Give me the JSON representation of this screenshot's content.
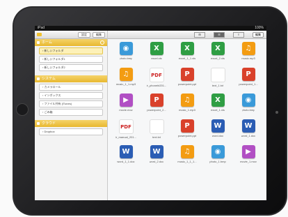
{
  "status": {
    "carrier": "iPad",
    "battery": "100%"
  },
  "sidebar": {
    "top_buttons": [
      "設定",
      "編集"
    ],
    "home": {
      "title": "ホーム",
      "items": [
        "新しいフォルダ",
        "新しいフォルダ1",
        "新しいフォルダ2"
      ]
    },
    "system": {
      "title": "システム",
      "items": [
        "カメラロール",
        "インボックス",
        "ファイル共有 (iTunes)",
        "ごみ箱"
      ]
    },
    "cloud": {
      "title": "クラウド",
      "items": [
        "Dropbox"
      ]
    }
  },
  "toolbar": {
    "edit": "編集",
    "views": [
      "⊞",
      "☰",
      "≡"
    ]
  },
  "colors": {
    "excel": "#2f9e44",
    "ppt": "#d9412b",
    "word": "#2b5db4",
    "music": "#f39c12",
    "photo": "#3a9ad9",
    "movie": "#b14fc4"
  },
  "files": [
    {
      "name": "photo.bmp",
      "kind": "photo",
      "glyph": "◉"
    },
    {
      "name": "excel.xls",
      "kind": "excel",
      "glyph": "X"
    },
    {
      "name": "excel_1_1.xls",
      "kind": "excel",
      "glyph": "X"
    },
    {
      "name": "excel_2.xls",
      "kind": "excel",
      "glyph": "X"
    },
    {
      "name": "music.mp3",
      "kind": "music",
      "glyph": "♫"
    },
    {
      "name": "music_1_1.mp3",
      "kind": "music",
      "glyph": "♫"
    },
    {
      "name": "ir_phonebi201...",
      "kind": "pdf",
      "glyph": "PDF"
    },
    {
      "name": "powerpoint.ppt",
      "kind": "ppt",
      "glyph": "P"
    },
    {
      "name": "text_1.txt",
      "kind": "txt",
      "glyph": ""
    },
    {
      "name": "powerpoint_1...",
      "kind": "ppt",
      "glyph": "P"
    },
    {
      "name": "movie.mov",
      "kind": "movie",
      "glyph": "▶"
    },
    {
      "name": "powerpoint_2...",
      "kind": "ppt",
      "glyph": "P"
    },
    {
      "name": "music_1.mp3",
      "kind": "music",
      "glyph": "♫"
    },
    {
      "name": "excel_1.xls",
      "kind": "excel",
      "glyph": "X"
    },
    {
      "name": "photo.bmp",
      "kind": "photo",
      "glyph": "◉"
    },
    {
      "name": "ir_manual_201...",
      "kind": "pdf",
      "glyph": "PDF"
    },
    {
      "name": "text.txt",
      "kind": "txt",
      "glyph": ""
    },
    {
      "name": "powerpoint.ppt",
      "kind": "ppt",
      "glyph": "P"
    },
    {
      "name": "word.doc",
      "kind": "word",
      "glyph": "W"
    },
    {
      "name": "word_1.doc",
      "kind": "word",
      "glyph": "W"
    },
    {
      "name": "word_1_1.doc",
      "kind": "word",
      "glyph": "W"
    },
    {
      "name": "word_2.doc",
      "kind": "word",
      "glyph": "W"
    },
    {
      "name": "music_1_1_1...",
      "kind": "music",
      "glyph": "♫"
    },
    {
      "name": "photo_1.bmp",
      "kind": "photo",
      "glyph": "◉"
    },
    {
      "name": "movie_1.mov",
      "kind": "movie",
      "glyph": "▶"
    }
  ]
}
